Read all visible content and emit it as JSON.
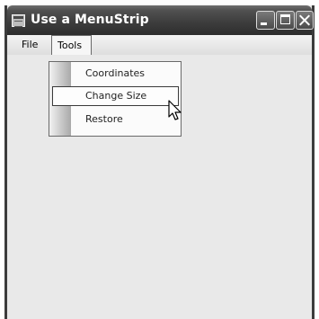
{
  "window": {
    "title": "Use a MenuStrip",
    "icon": "app-window-icon",
    "controls": [
      "minimize-icon",
      "maximize-icon",
      "close-icon"
    ]
  },
  "menubar": {
    "items": [
      {
        "label": "File"
      },
      {
        "label": "Tools"
      }
    ]
  },
  "tools_menu": {
    "items": [
      {
        "label": "Coordinates"
      },
      {
        "label": "Change Size",
        "highlighted": true
      },
      {
        "label": "Restore"
      }
    ]
  },
  "colors": {
    "titlebar": "#3e3e3e",
    "client": "#e9e9e9",
    "menu_highlight_border": "#3a3a3a"
  }
}
